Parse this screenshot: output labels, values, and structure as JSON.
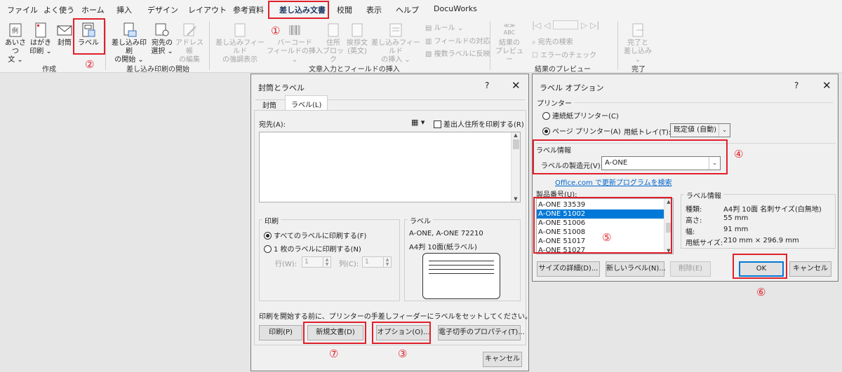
{
  "ribbon": {
    "tabs": [
      "ファイル",
      "よく使う",
      "ホーム",
      "挿入",
      "デザイン",
      "レイアウト",
      "参考資料",
      "差し込み文書",
      "校閲",
      "表示",
      "ヘルプ",
      "DocuWorks"
    ],
    "active_tab": "差し込み文書",
    "create": {
      "aisatsu": "あいさつ\n文 ⌄",
      "hagaki": "はがき\n印刷 ⌄",
      "envelope": "封筒",
      "label": "ラベル",
      "group": "作成"
    },
    "start": {
      "start_merge": "差し込み印刷\nの開始 ⌄",
      "select_recipients": "宛先の\n選択 ⌄",
      "edit_list": "アドレス帳\nの編集",
      "group": "差し込み印刷の開始"
    },
    "fields": {
      "highlight": "差し込みフィールド\nの強調表示",
      "barcode": "バーコード\nフィールドの挿入 ⌄",
      "address_block": "住所\nブロック",
      "greeting": "挨拶文\n(英文)",
      "insert_field": "差し込みフィールド\nの挿入 ⌄",
      "rules": "ルール ⌄",
      "match_fields": "フィールドの対応",
      "update_labels": "複数ラベルに反映",
      "group": "文章入力とフィールドの挿入"
    },
    "preview": {
      "preview_results": "結果の\nプレビュー",
      "abc": "≪≫\nABC",
      "find_recipient": "宛先の検索",
      "check_errors": "エラーのチェック",
      "group": "結果のプレビュー"
    },
    "finish": {
      "finish_merge": "完了と\n差し込み ⌄",
      "group": "完了"
    }
  },
  "dialog1": {
    "title": "封筒とラベル",
    "help": "?",
    "close": "✕",
    "tabs": [
      "封筒",
      "ラベル(L)"
    ],
    "address_label": "宛先(A):",
    "return_address_check": "差出人住所を印刷する(R)",
    "print_group": "印刷",
    "print_full": "すべてのラベルに印刷する(F)",
    "print_single": "1 枚のラベルに印刷する(N)",
    "row_label": "行(W):",
    "row_value": "1",
    "col_label": "列(C):",
    "col_value": "1",
    "label_group": "ラベル",
    "label_vendor": "A-ONE, A-ONE 72210",
    "label_desc": "A4判 10面(紙ラベル)",
    "note": "印刷を開始する前に、プリンターの手差しフィーダーにラベルをセットしてください。",
    "btn_print": "印刷(P)",
    "btn_new_doc": "新規文書(D)",
    "btn_options": "オプション(O)...",
    "btn_epostage": "電子切手のプロパティ(T)...",
    "btn_cancel": "キャンセル"
  },
  "dialog2": {
    "title": "ラベル オプション",
    "help": "?",
    "close": "✕",
    "printer_info": "プリンター",
    "continuous": "連続紙プリンター(C)",
    "page_printer": "ページ プリンター(A)",
    "tray_label": "用紙トレイ(T):",
    "tray_value": "既定値 (自動)",
    "label_info_group": "ラベル情報",
    "vendor_label": "ラベルの製造元(V):",
    "vendor_value": "A-ONE",
    "update_link": "Office.com で更新プログラムを検索",
    "product_label": "製品番号(U):",
    "products": [
      "A-ONE 33539",
      "A-ONE 51002",
      "A-ONE 51006",
      "A-ONE 51008",
      "A-ONE 51017",
      "A-ONE 51027"
    ],
    "selected_index": 1,
    "info_group": "ラベル情報",
    "info_type_k": "種類:",
    "info_type_v": "A4判 10面 名刺サイズ(白無地)",
    "info_h_k": "高さ:",
    "info_h_v": "55 mm",
    "info_w_k": "幅:",
    "info_w_v": "91 mm",
    "info_p_k": "用紙サイズ:",
    "info_p_v": "210 mm × 296.9 mm",
    "btn_details": "サイズの詳細(D)...",
    "btn_new_label": "新しいラベル(N)...",
    "btn_delete": "削除(E)",
    "btn_ok": "OK",
    "btn_cancel": "キャンセル"
  },
  "markers": [
    "①",
    "②",
    "③",
    "④",
    "⑤",
    "⑥",
    "⑦"
  ],
  "colors": {
    "highlight": "#e0202a",
    "selection": "#0078d7",
    "link": "#0066cc"
  }
}
